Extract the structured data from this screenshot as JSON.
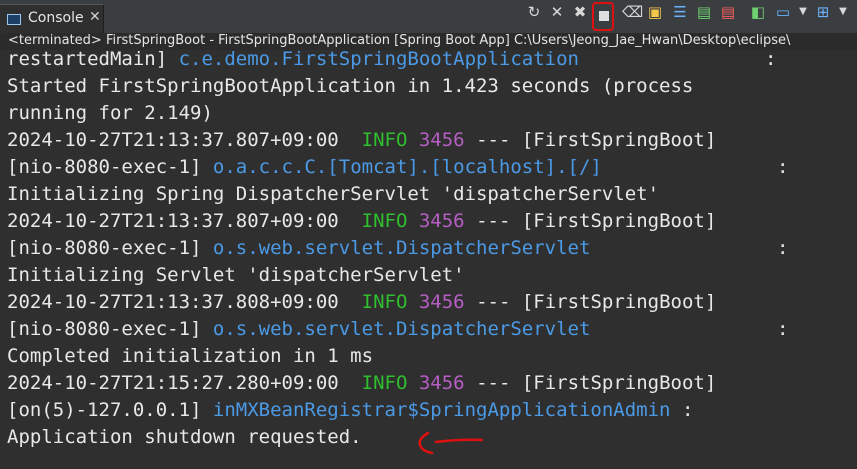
{
  "tab": {
    "label": "Console",
    "close": "✕"
  },
  "toolbar": {
    "icons": [
      "refresh-icon",
      "remove-launch-icon",
      "remove-all-icon",
      "terminate-icon",
      "clear-console-icon",
      "scroll-lock-icon",
      "word-wrap-icon",
      "show-stdout-icon",
      "show-stderr-icon",
      "pin-console-icon",
      "display-console-icon",
      "new-console-icon"
    ]
  },
  "status": "<terminated> FirstSpringBoot - FirstSpringBootApplication [Spring Boot App] C:\\Users\\Jeong_Jae_Hwan\\Desktop\\eclipse\\",
  "console": {
    "l1_thread": "restartedMain]",
    "l1_logger": "c.e.demo.FirstSpringBootApplication",
    "l2": "Started FirstSpringBootApplication in 1.423 seconds (process",
    "l3": "running for 2.149)",
    "entries": [
      {
        "ts": "2024-10-27T21:13:37.807+09:00",
        "level": "INFO",
        "pid": "3456",
        "sep": "---",
        "app": "[FirstSpringBoot]",
        "thread": "[nio-8080-exec-1]",
        "logger": "o.a.c.c.C.[Tomcat].[localhost].[/]",
        "msg": "Initializing Spring DispatcherServlet 'dispatcherServlet'"
      },
      {
        "ts": "2024-10-27T21:13:37.807+09:00",
        "level": "INFO",
        "pid": "3456",
        "sep": "---",
        "app": "[FirstSpringBoot]",
        "thread": "[nio-8080-exec-1]",
        "logger": "o.s.web.servlet.DispatcherServlet",
        "msg": "Initializing Servlet 'dispatcherServlet'"
      },
      {
        "ts": "2024-10-27T21:13:37.808+09:00",
        "level": "INFO",
        "pid": "3456",
        "sep": "---",
        "app": "[FirstSpringBoot]",
        "thread": "[nio-8080-exec-1]",
        "logger": "o.s.web.servlet.DispatcherServlet",
        "msg": "Completed initialization in 1 ms"
      },
      {
        "ts": "2024-10-27T21:15:27.280+09:00",
        "level": "INFO",
        "pid": "3456",
        "sep": "---",
        "app": "[FirstSpringBoot]",
        "thread": "[on(5)-127.0.0.1]",
        "logger": "inMXBeanRegistrar$SpringApplicationAdmin",
        "msg": "Application shutdown requested."
      }
    ],
    "colon": ":"
  },
  "colors": {
    "logger": "#4b9ae6",
    "info": "#2fbf2f",
    "pid": "#b65ec4",
    "annotation": "#e01010"
  }
}
